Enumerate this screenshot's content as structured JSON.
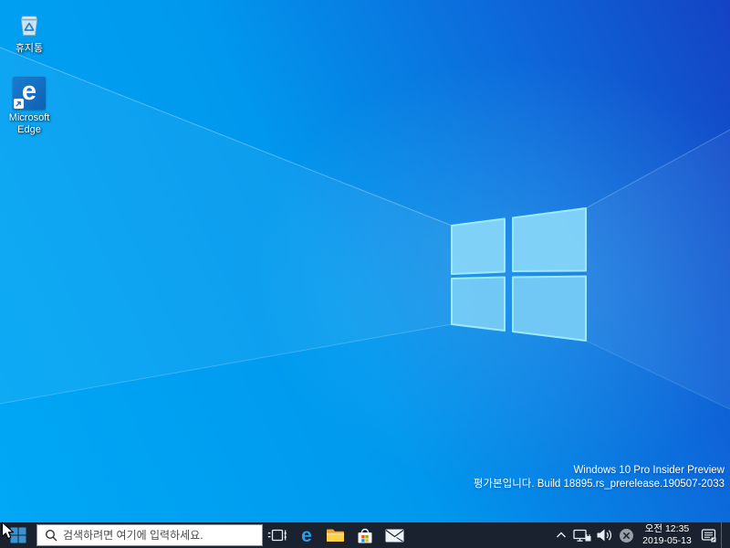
{
  "desktop": {
    "icons": [
      {
        "name": "recycle-bin",
        "label": "휴지통"
      },
      {
        "name": "microsoft-edge-shortcut",
        "label": "Microsoft Edge"
      }
    ],
    "watermark": {
      "line1": "Windows 10 Pro Insider Preview",
      "line2": "평가본입니다. Build 18895.rs_prerelease.190507-2033"
    }
  },
  "taskbar": {
    "search": {
      "placeholder": "검색하려면 여기에 입력하세요."
    },
    "buttons": [
      "task-view",
      "microsoft-edge",
      "file-explorer",
      "microsoft-store",
      "mail"
    ],
    "tray": {
      "clock_time": "오전 12:35",
      "clock_date": "2019-05-13"
    }
  },
  "icons": {
    "edge_glyph": "e"
  },
  "colors": {
    "taskbar_bg": "#19222e",
    "wallpaper_bright": "#00a8f5",
    "wallpaper_deep": "#1443c4",
    "start_flag": "#3994d1",
    "edge_blue": "#2a9ce8",
    "folder_yellow": "#ffca28",
    "store_red": "#f25022",
    "store_green": "#7fba00",
    "store_blue": "#00a4ef",
    "store_yellow": "#ffb900"
  }
}
